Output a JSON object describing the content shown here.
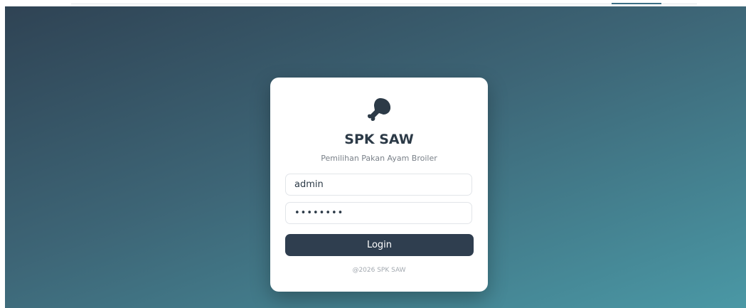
{
  "login_card": {
    "logo_icon": "chicken-drumstick-icon",
    "title": "SPK SAW",
    "subtitle": "Pemilihan Pakan Ayam Broiler",
    "username_value": "admin",
    "password_value": "••••••••",
    "login_label": "Login",
    "footer": "@2026 SPK SAW"
  },
  "colors": {
    "gradient_start": "#2f4354",
    "gradient_end": "#4a98a5",
    "button": "#2f3e4f",
    "title": "#2c3a47"
  }
}
